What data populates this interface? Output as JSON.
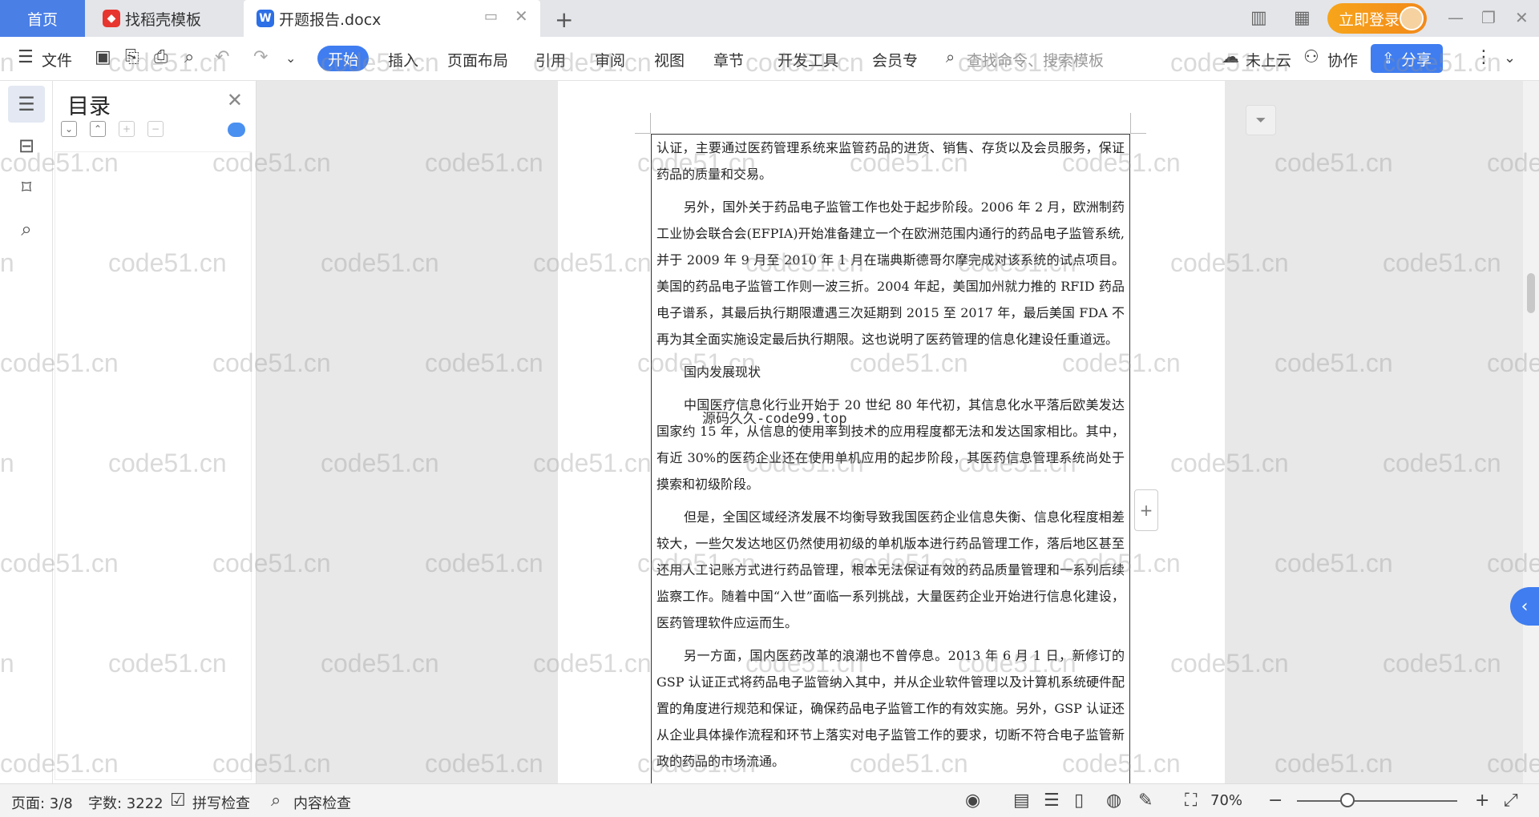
{
  "tabs": {
    "home": "首页",
    "templates": "找稻壳模板",
    "document": "开题报告.docx"
  },
  "top_right": {
    "login": "立即登录"
  },
  "ribbon": {
    "file": "文件",
    "menus": [
      "开始",
      "插入",
      "页面布局",
      "引用",
      "审阅",
      "视图",
      "章节",
      "开发工具",
      "会员专"
    ],
    "search_placeholder": "查找命令、搜索模板",
    "cloud": "未上云",
    "collab": "协作",
    "share": "分享"
  },
  "toc": {
    "title": "目录"
  },
  "document": {
    "paragraphs": [
      {
        "indent": false,
        "text": "认证，主要通过医药管理系统来监管药品的进货、销售、存货以及会员服务，保证药品的质量和交易。"
      },
      {
        "indent": true,
        "text": "另外，国外关于药品电子监管工作也处于起步阶段。2006 年 2 月，欧洲制药工业协会联合会(EFPIA)开始准备建立一个在欧洲范围内通行的药品电子监管系统,并于 2009 年 9 月至 2010 年 1 月在瑞典斯德哥尔摩完成对该系统的试点项目。美国的药品电子监管工作则一波三折。2004 年起，美国加州就力推的 RFID 药品电子谱系，其最后执行期限遭遇三次延期到 2015 至 2017 年，最后美国 FDA 不再为其全面实施设定最后执行期限。这也说明了医药管理的信息化建设任重道远。"
      },
      {
        "indent": true,
        "text": "国内发展现状"
      },
      {
        "indent": true,
        "text": "中国医疗信息化行业开始于 20 世纪 80 年代初，其信息化水平落后欧美发达国家约 15 年，从信息的使用率到技术的应用程度都无法和发达国家相比。其中，有近 30%的医药企业还在使用单机应用的起步阶段，其医药信息管理系统尚处于摸索和初级阶段。"
      },
      {
        "indent": true,
        "text": "但是，全国区域经济发展不均衡导致我国医药企业信息失衡、信息化程度相差较大，一些欠发达地区仍然使用初级的单机版本进行药品管理工作，落后地区甚至还用人工记账方式进行药品管理，根本无法保证有效的药品质量管理和一系列后续监察工作。随着中国“入世”面临一系列挑战，大量医药企业开始进行信息化建设，医药管理软件应运而生。"
      },
      {
        "indent": true,
        "text": "另一方面，国内医药改革的浪潮也不曾停息。2013 年 6 月 1 日，新修订的 GSP 认证正式将药品电子监管纳入其中，并从企业软件管理以及计算机系统硬件配置的角度进行规范和保证，确保药品电子监管工作的有效实施。另外，GSP 认证还从企业具体操作流程和环节上落实对电子监管工作的要求，切断不符合电子监管新政的药品的市场流通。"
      }
    ],
    "overlay": "源码久久-code99.top"
  },
  "watermark": "code51.cn",
  "status": {
    "page": "页面: 3/8",
    "words": "字数: 3222",
    "spell": "拼写检查",
    "content_check": "内容检查",
    "zoom": "70%"
  },
  "colors": {
    "accent": "#3f7df0",
    "login": "#f2891a"
  }
}
